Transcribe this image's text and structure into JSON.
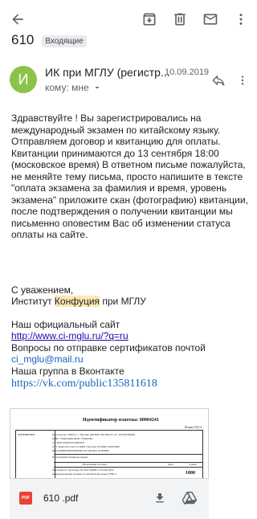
{
  "toolbar": {
    "back_icon": "arrow-back-icon",
    "archive_icon": "archive-icon",
    "delete_icon": "delete-icon",
    "mark_unread_icon": "mail-icon",
    "more_icon": "more-vert-icon"
  },
  "subject": {
    "text": "610",
    "label": "Входящие"
  },
  "sender": {
    "avatar_letter": "И",
    "avatar_color": "#8bc34a",
    "name": "ИК при МГЛУ (регистр...",
    "date": "10.09.2019",
    "to_me": "кому: мне"
  },
  "body": {
    "para1": "Здравствуйте ! Вы зарегистрировались на международный экзамен по китайскому языку. Отправляем договор и квитанцию для оплаты. Квитанции принимаются до 13 сентября 18:00 (московское время) В ответном письме пожалуйста, не меняйте тему письма, просто напишите в тексте \"оплата экзамена за фамилия и время, уровень экзамена\" приложите скан (фотографию) квитанции, после подтверждения о получении квитанции мы письменно оповестим Вас об изменении статуса оплаты на сайте.",
    "regards": "С уважением,",
    "inst_before": "Институт ",
    "inst_hl": "Конфуция",
    "inst_after": " при МГЛУ",
    "site_label": "Наш официальный сайт",
    "site_url": "http://www.ci-mglu.ru/?q=ru",
    "cert_label": "Вопросы по отправке сертификатов почтой",
    "cert_email": "ci_mglu@mail.ru",
    "vk_label": "Наша группа в Вконтакте",
    "vk_url": "https://vk.com/public135811618"
  },
  "attachment": {
    "doc_title": "Идентификатор платежа: 00004241",
    "doc_form": "Форма ПД-4",
    "doc_left": "ИЗВЕЩЕНИЕ",
    "doc_line1": "Получатель: УФК по г. Москве (ФГБОУ ВО МГЛУ л/с 20736X58630)",
    "doc_line2": "ИНН 7704024466 КПП 770401001",
    "doc_line3": "р/с 40501810845252000079",
    "doc_line4": "в ГУ Банка России по ЦФО г.Москва 35 БИК 044525000",
    "doc_line5": "КБК 00000000000000000130 ОКТМО 45383000",
    "doc_line6": "Плательщик: Баринова Дарья",
    "doc_col1": "Назначение платежа",
    "doc_col2": "Дата",
    "doc_col3": "Сумма",
    "doc_line7": "Обучение по Договору № 610/19/ИМ от 09.09.2019 -",
    "doc_line8": "международный экзамен по китайскому языку HSK 2",
    "doc_amount": "1000",
    "file_name": "610 .pdf",
    "pdf_label": "PDF"
  }
}
